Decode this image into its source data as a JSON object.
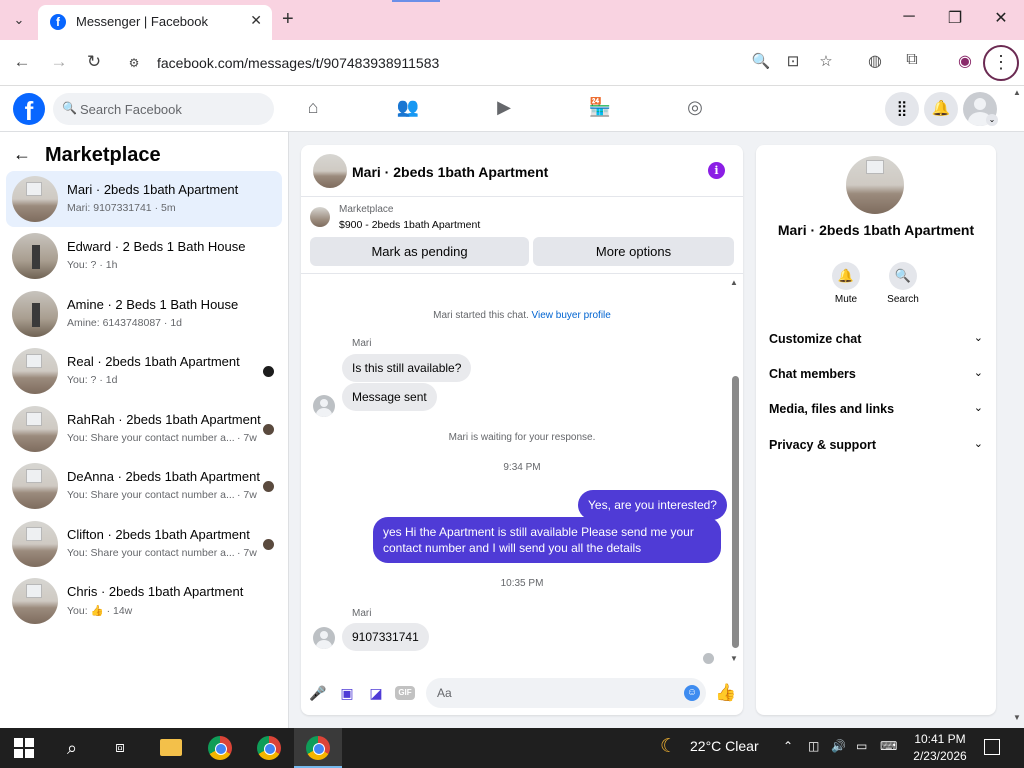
{
  "browser": {
    "tab_title": "Messenger | Facebook",
    "url": "facebook.com/messages/t/907483938911583"
  },
  "facebook": {
    "search_placeholder": "Search Facebook"
  },
  "sidebar": {
    "title": "Marketplace",
    "conversations": [
      {
        "name": "Mari · 2beds 1bath Apartment",
        "preview": "Mari: 9107331741",
        "time": "· 5m",
        "active": true
      },
      {
        "name": "Edward · 2 Beds 1 Bath House",
        "preview": "You: ?",
        "time": "· 1h"
      },
      {
        "name": "Amine · 2 Beds 1 Bath House",
        "preview": "Amine: 6143748087",
        "time": "· 1d"
      },
      {
        "name": "Real · 2beds 1bath Apartment",
        "preview": "You: ?",
        "time": "· 1d"
      },
      {
        "name": "RahRah · 2beds 1bath Apartment",
        "preview": "You: Share your contact number a...",
        "time": "· 7w"
      },
      {
        "name": "DeAnna · 2beds 1bath Apartment",
        "preview": "You: Share your contact number a...",
        "time": "· 7w"
      },
      {
        "name": "Clifton · 2beds 1bath Apartment",
        "preview": "You: Share your contact number a...",
        "time": "· 7w"
      },
      {
        "name": "Chris · 2beds 1bath Apartment",
        "preview": "You: 👍",
        "time": "· 14w"
      }
    ]
  },
  "chat": {
    "header_name": "Mari · 2beds 1bath Apartment",
    "marketplace_label": "Marketplace",
    "listing": "$900 - 2beds 1bath Apartment",
    "mark_pending": "Mark as pending",
    "more_options": "More options",
    "started_text": "Mari started this chat.",
    "view_buyer_profile": "View buyer profile",
    "sender": "Mari",
    "msg1": "Is this still available?",
    "msg2": "Message sent",
    "waiting_text": "Mari is waiting for your response.",
    "time1": "9:34 PM",
    "out1": "Yes, are you interested?",
    "out2": "yes Hi the Apartment is still available Please send me your contact number and I will send you all the details",
    "time2": "10:35 PM",
    "sender2": "Mari",
    "msg3": "9107331741",
    "composer_placeholder": "Aa"
  },
  "right_panel": {
    "name": "Mari · 2beds 1bath Apartment",
    "mute_label": "Mute",
    "search_label": "Search",
    "sections": [
      "Customize chat",
      "Chat members",
      "Media, files and links",
      "Privacy & support"
    ]
  },
  "taskbar": {
    "weather": "22°C  Clear",
    "time": "10:41 PM",
    "date": "2/23/2026"
  }
}
